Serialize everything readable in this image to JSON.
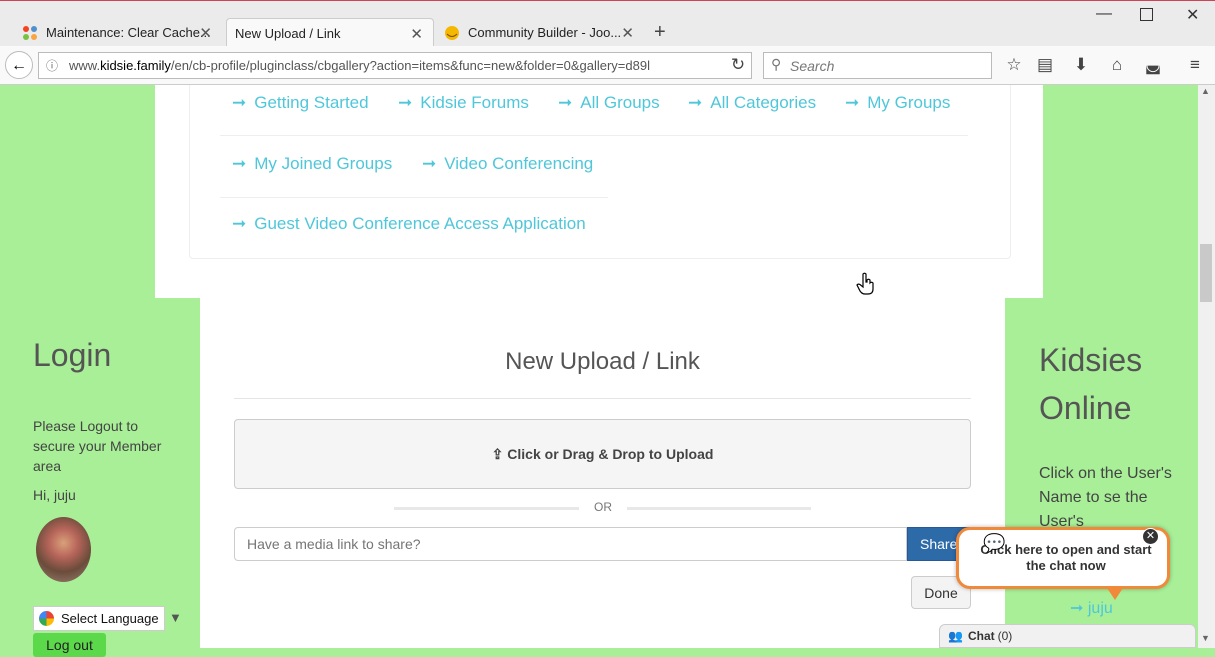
{
  "browser": {
    "tabs": [
      {
        "label": "Maintenance: Clear Cache...",
        "icon": "joomla-icon",
        "active": false
      },
      {
        "label": "New Upload / Link",
        "icon": "",
        "active": true
      },
      {
        "label": "Community Builder - Joo...",
        "icon": "emoji-icon",
        "active": false
      }
    ],
    "url_prefix": "www.",
    "url_domain": "kidsie.family",
    "url_path": "/en/cb-profile/pluginclass/cbgallery?action=items&func=new&folder=0&gallery=d89l",
    "search_placeholder": "Search"
  },
  "menu": {
    "links": [
      {
        "label": "Getting Started"
      },
      {
        "label": "Kidsie Forums"
      },
      {
        "label": "All Groups"
      },
      {
        "label": "All Categories"
      },
      {
        "label": "My Groups"
      },
      {
        "label": "My Joined Groups"
      },
      {
        "label": "Video Conferencing"
      },
      {
        "label": "Guest Video Conference Access Application"
      }
    ]
  },
  "main": {
    "title": "New Upload / Link",
    "upload_label": "Click or Drag & Drop to Upload",
    "or_label": "OR",
    "media_placeholder": "Have a media link to share?",
    "share_label": "Share",
    "done_label": "Done"
  },
  "login": {
    "title": "Login",
    "note": "Please Logout to secure your Member area",
    "greeting": "Hi, juju",
    "language_label": "Select Language",
    "logout_label": "Log out"
  },
  "online": {
    "title": "Kidsies Online",
    "note": "Click on the User's Name to se the User's",
    "user": "juju"
  },
  "chat": {
    "bubble_text": "Click here to open and start the chat now",
    "bar_label": "Chat",
    "count": "(0)"
  },
  "colors": {
    "accent_link": "#4fc7da",
    "page_bg": "#a8ef98",
    "share_button": "#2d6aa8",
    "chat_border": "#f08a3a"
  }
}
